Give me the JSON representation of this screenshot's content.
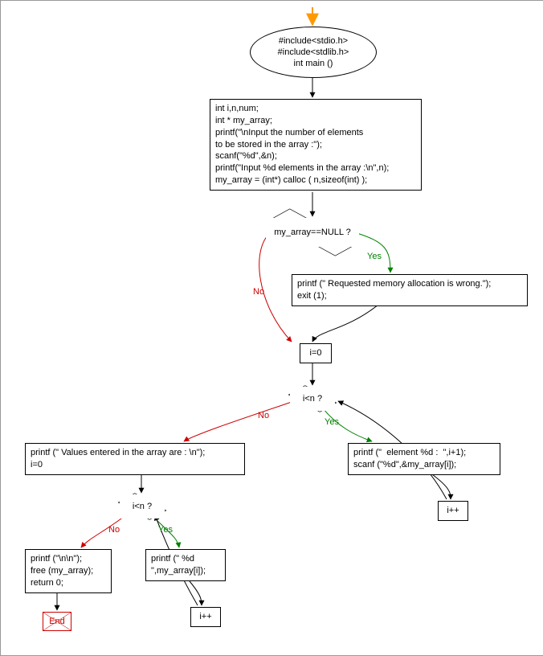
{
  "chart_data": {
    "type": "flowchart",
    "title": "",
    "nodes": [
      {
        "id": "start",
        "shape": "ellipse",
        "text": "#include<stdio.h>\n#include<stdlib.h>\nint main ()"
      },
      {
        "id": "decl",
        "shape": "rect",
        "text": "int i,n,num;\nint * my_array;\nprintf(\"\\nInput the number of elements\nto be stored in the array :\");\nscanf(\"%d\",&n);\nprintf(\"Input %d elements in the array :\\n\",n);\nmy_array = (int*) calloc ( n,sizeof(int) );"
      },
      {
        "id": "chk",
        "shape": "diamond",
        "text": "my_array==NULL ?"
      },
      {
        "id": "err",
        "shape": "rect",
        "text": "printf (\" Requested memory allocation is wrong.\");\nexit (1);"
      },
      {
        "id": "init1",
        "shape": "rect",
        "text": "i=0"
      },
      {
        "id": "cond1",
        "shape": "diamond",
        "text": "i<n ?"
      },
      {
        "id": "read",
        "shape": "rect",
        "text": "printf (\"  element %d :  \",i+1);\nscanf (\"%d\",&my_array[i]);"
      },
      {
        "id": "inc1",
        "shape": "rect",
        "text": "i++"
      },
      {
        "id": "msg",
        "shape": "rect",
        "text": "printf (\" Values entered in the array are : \\n\");\ni=0"
      },
      {
        "id": "cond2",
        "shape": "diamond",
        "text": "i<n ?"
      },
      {
        "id": "print",
        "shape": "rect",
        "text": "printf (\" %d \n\",my_array[i]);"
      },
      {
        "id": "inc2",
        "shape": "rect",
        "text": "i++"
      },
      {
        "id": "done",
        "shape": "rect",
        "text": "printf (\"\\n\\n\");\nfree (my_array);\nreturn 0;"
      },
      {
        "id": "end",
        "shape": "terminator",
        "text": "End"
      }
    ],
    "edges": [
      {
        "from": "entry",
        "to": "start"
      },
      {
        "from": "start",
        "to": "decl"
      },
      {
        "from": "decl",
        "to": "chk"
      },
      {
        "from": "chk",
        "to": "err",
        "label": "Yes"
      },
      {
        "from": "chk",
        "to": "init1",
        "label": "No"
      },
      {
        "from": "err",
        "to": "init1"
      },
      {
        "from": "init1",
        "to": "cond1"
      },
      {
        "from": "cond1",
        "to": "read",
        "label": "Yes"
      },
      {
        "from": "read",
        "to": "inc1"
      },
      {
        "from": "inc1",
        "to": "cond1"
      },
      {
        "from": "cond1",
        "to": "msg",
        "label": "No"
      },
      {
        "from": "msg",
        "to": "cond2"
      },
      {
        "from": "cond2",
        "to": "print",
        "label": "Yes"
      },
      {
        "from": "print",
        "to": "inc2"
      },
      {
        "from": "inc2",
        "to": "cond2"
      },
      {
        "from": "cond2",
        "to": "done",
        "label": "No"
      },
      {
        "from": "done",
        "to": "end"
      }
    ],
    "edge_labels": {
      "yes": "Yes",
      "no": "No"
    }
  }
}
